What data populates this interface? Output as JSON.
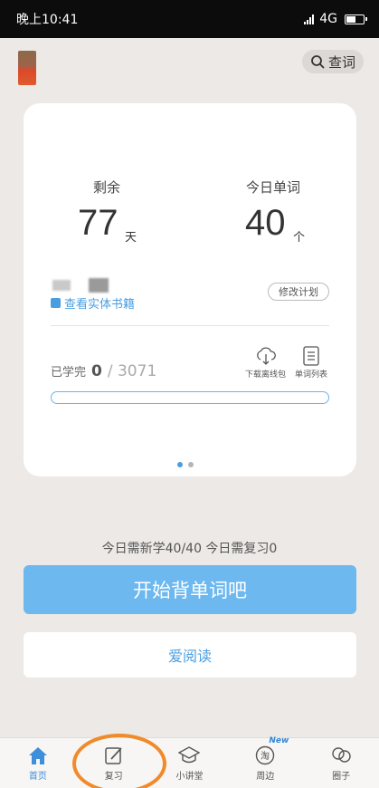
{
  "status_bar": {
    "time": "晚上10:41",
    "network": "4G"
  },
  "header": {
    "search_label": "查词"
  },
  "plan_card": {
    "remaining_label": "剩余",
    "remaining_value": "77",
    "remaining_unit": "天",
    "today_words_label": "今日单词",
    "today_words_value": "40",
    "today_words_unit": "个",
    "view_books_label": "查看实体书籍",
    "modify_plan_label": "修改计划",
    "learned_label": "已学完",
    "learned_count": "0",
    "total_count": "/ 3071",
    "download_label": "下载离线包",
    "word_list_label": "单词列表",
    "progress_fraction": 0,
    "page_dots": 2,
    "active_dot": 0
  },
  "today_summary": "今日需新学40/40  今日需复习0",
  "start_button_label": "开始背单词吧",
  "read_button_label": "爱阅读",
  "bottom_nav": {
    "items": [
      {
        "label": "首页",
        "icon": "home-icon",
        "active": true
      },
      {
        "label": "复习",
        "icon": "edit-icon",
        "active": false
      },
      {
        "label": "小讲堂",
        "icon": "graduation-cap-icon",
        "active": false
      },
      {
        "label": "周边",
        "icon": "shop-icon",
        "active": false,
        "badge": "New"
      },
      {
        "label": "圈子",
        "icon": "group-icon",
        "active": false
      }
    ]
  },
  "colors": {
    "accent": "#4a9ee0",
    "primary_button": "#6cb8ef",
    "highlight_ring": "#f08a2a"
  }
}
